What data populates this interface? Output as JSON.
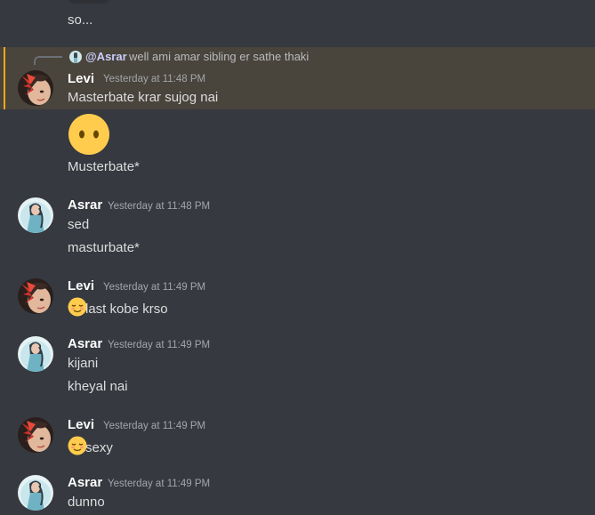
{
  "top_message": {
    "text": "so..."
  },
  "reply": {
    "mention": "@Asrar",
    "text": "well ami amar sibling er sathe thaki"
  },
  "messages": [
    {
      "author": "Levi",
      "timestamp": "Yesterday at 11:48 PM",
      "lines": [
        "Masterbate krar sujog nai",
        "Musterbate*"
      ],
      "emoji": "face-without-mouth-emoji"
    },
    {
      "author": "Asrar",
      "timestamp": "Yesterday at 11:48 PM",
      "lines": [
        "sed",
        "masturbate*"
      ]
    },
    {
      "author": "Levi",
      "timestamp": "Yesterday at 11:49 PM",
      "lines": [
        "last kobe krso"
      ],
      "emoji": "relieved-face-emoji"
    },
    {
      "author": "Asrar",
      "timestamp": "Yesterday at 11:49 PM",
      "lines": [
        "kijani",
        "kheyal nai"
      ]
    },
    {
      "author": "Levi",
      "timestamp": "Yesterday at 11:49 PM",
      "lines": [
        "sexy"
      ],
      "emoji": "relieved-face-emoji"
    },
    {
      "author": "Asrar",
      "timestamp": "Yesterday at 11:49 PM",
      "lines": [
        "dunno"
      ]
    }
  ],
  "colors": {
    "background": "#36393f",
    "mention_highlight": "#49443c",
    "mention_bar": "#faa81a",
    "username": "#ffffff",
    "timestamp": "#a3a6aa",
    "text": "#dcddde"
  }
}
